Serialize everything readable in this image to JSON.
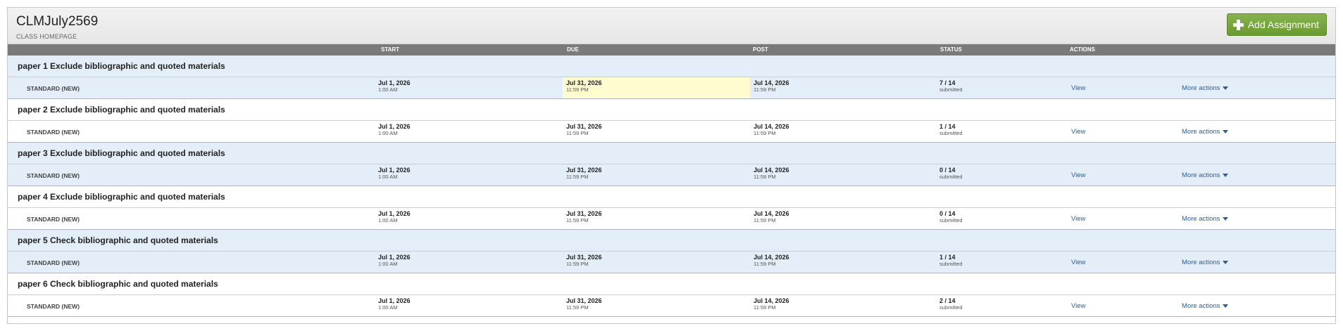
{
  "header": {
    "class_title": "CLMJuly2569",
    "class_subtitle": "CLASS HOMEPAGE",
    "add_button": "Add Assignment"
  },
  "columns": {
    "start": "START",
    "due": "DUE",
    "post": "POST",
    "status": "STATUS",
    "actions": "ACTIONS"
  },
  "assignments": [
    {
      "title": "paper 1 Exclude bibliographic and quoted materials",
      "type": "STANDARD (NEW)",
      "start_date": "Jul 1, 2026",
      "start_time": "1:00 AM",
      "due_date": "Jul 31, 2026",
      "due_time": "11:59 PM",
      "post_date": "Jul 14, 2026",
      "post_time": "11:59 PM",
      "status": "7 / 14",
      "status_label": "submitted",
      "view": "View",
      "more": "More actions"
    },
    {
      "title": "paper 2 Exclude bibliographic and quoted materials",
      "type": "STANDARD (NEW)",
      "start_date": "Jul 1, 2026",
      "start_time": "1:00 AM",
      "due_date": "Jul 31, 2026",
      "due_time": "11:59 PM",
      "post_date": "Jul 14, 2026",
      "post_time": "11:59 PM",
      "status": "1 / 14",
      "status_label": "submitted",
      "view": "View",
      "more": "More actions"
    },
    {
      "title": "paper 3 Exclude bibliographic and quoted materials",
      "type": "STANDARD (NEW)",
      "start_date": "Jul 1, 2026",
      "start_time": "1:00 AM",
      "due_date": "Jul 31, 2026",
      "due_time": "11:59 PM",
      "post_date": "Jul 14, 2026",
      "post_time": "11:59 PM",
      "status": "0 / 14",
      "status_label": "submitted",
      "view": "View",
      "more": "More actions"
    },
    {
      "title": "paper 4 Exclude bibliographic and quoted materials",
      "type": "STANDARD (NEW)",
      "start_date": "Jul 1, 2026",
      "start_time": "1:00 AM",
      "due_date": "Jul 31, 2026",
      "due_time": "11:59 PM",
      "post_date": "Jul 14, 2026",
      "post_time": "11:59 PM",
      "status": "0 / 14",
      "status_label": "submitted",
      "view": "View",
      "more": "More actions"
    },
    {
      "title": "paper 5 Check bibliographic and quoted materials",
      "type": "STANDARD (NEW)",
      "start_date": "Jul 1, 2026",
      "start_time": "1:00 AM",
      "due_date": "Jul 31, 2026",
      "due_time": "11:59 PM",
      "post_date": "Jul 14, 2026",
      "post_time": "11:59 PM",
      "status": "1 / 14",
      "status_label": "submitted",
      "view": "View",
      "more": "More actions"
    },
    {
      "title": "paper 6 Check bibliographic and quoted materials",
      "type": "STANDARD (NEW)",
      "start_date": "Jul 1, 2026",
      "start_time": "1:00 AM",
      "due_date": "Jul 31, 2026",
      "due_time": "11:59 PM",
      "post_date": "Jul 14, 2026",
      "post_time": "11:59 PM",
      "status": "2 / 14",
      "status_label": "submitted",
      "view": "View",
      "more": "More actions"
    }
  ],
  "colors": {
    "add_button": "#6a9a30",
    "column_header": "#7a7a7a",
    "row_shade": "#e4eef8",
    "due_highlight": "#fffccf",
    "link": "#2a5f9e"
  },
  "icons": {
    "add": "plus-icon",
    "more_actions": "caret-down-icon"
  }
}
